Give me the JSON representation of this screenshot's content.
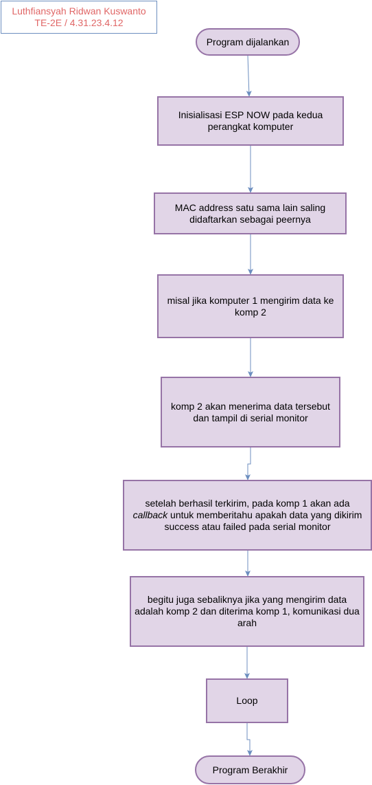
{
  "author": {
    "name": "Luthfiansyah Ridwan Kuswanto",
    "id_line": "TE-2E / 4.31.23.4.12",
    "text_color": "#e06666",
    "border_color": "#6c8ebf"
  },
  "colors": {
    "node_fill": "#e1d5e7",
    "node_stroke": "#9673a6",
    "edge": "#6c8ebf"
  },
  "nodes": {
    "start": {
      "label": "Program dijalankan",
      "shape": "terminal"
    },
    "step1": {
      "label": "Inisialisasi ESP NOW pada kedua perangkat komputer",
      "shape": "process"
    },
    "step2": {
      "label": "MAC address satu sama lain saling didaftarkan sebagai peernya",
      "shape": "process"
    },
    "step3": {
      "label": "misal jika komputer 1 mengirim data ke komp 2",
      "shape": "process"
    },
    "step4": {
      "label": "komp 2 akan menerima data tersebut dan tampil di serial monitor",
      "shape": "process"
    },
    "step5": {
      "label_part1": "setelah berhasil terkirim, pada komp 1 akan ada",
      "label_italic": "callback",
      "label_part2": "untuk memberitahu apakah data yang dikirim success atau failed pada serial monitor",
      "shape": "process"
    },
    "step6": {
      "label": "begitu juga sebaliknya jika yang mengirim data adalah komp 2 dan diterima komp 1, komunikasi dua arah",
      "shape": "process"
    },
    "loop": {
      "label": "Loop",
      "shape": "process"
    },
    "end": {
      "label": "Program Berakhir",
      "shape": "terminal"
    }
  },
  "edges": [
    {
      "from": "start",
      "to": "step1"
    },
    {
      "from": "step1",
      "to": "step2"
    },
    {
      "from": "step2",
      "to": "step3"
    },
    {
      "from": "step3",
      "to": "step4"
    },
    {
      "from": "step4",
      "to": "step5"
    },
    {
      "from": "step5",
      "to": "step6"
    },
    {
      "from": "step6",
      "to": "loop"
    },
    {
      "from": "loop",
      "to": "end"
    }
  ]
}
